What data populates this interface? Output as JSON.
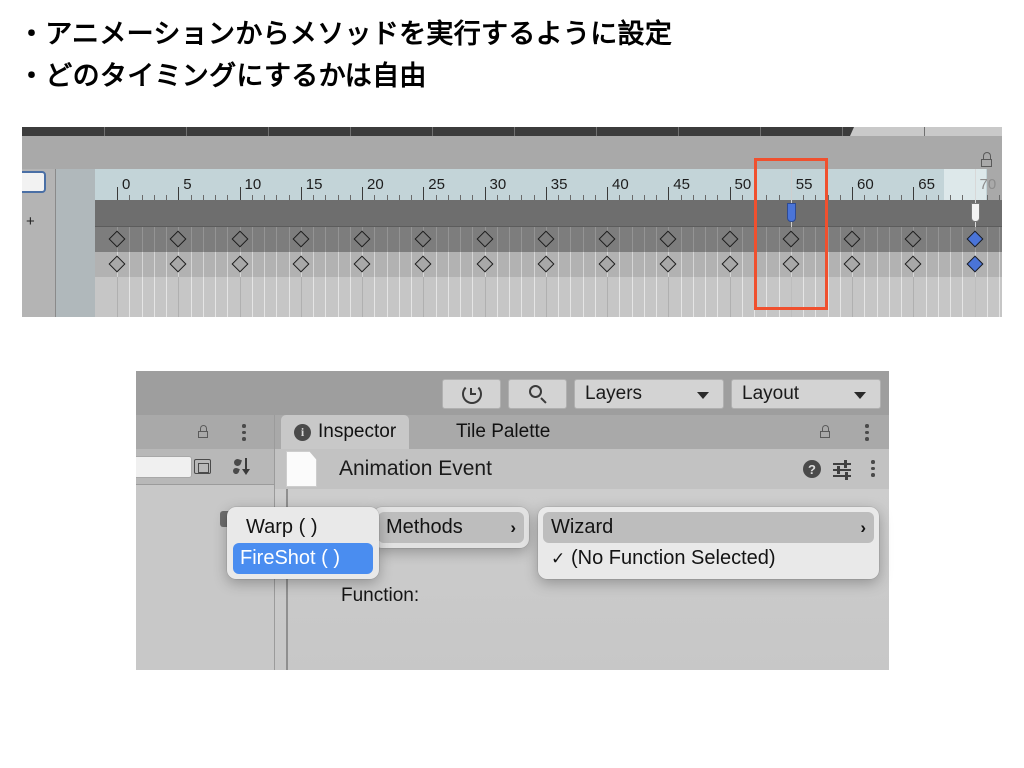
{
  "slide": {
    "bullets": [
      "・アニメーションからメソッドを実行するように設定",
      "・どのタイミングにするかは自由"
    ]
  },
  "timeline": {
    "ruler": {
      "labels": [
        "0",
        "5",
        "10",
        "15",
        "20",
        "25",
        "30",
        "35",
        "40",
        "45",
        "50",
        "55",
        "60",
        "65",
        "70"
      ],
      "frame_start": 0,
      "frame_end": 70,
      "tick_step": 5,
      "minor_per_major": 5
    },
    "playheads": [
      {
        "name": "current-frame-marker",
        "frame": 55,
        "color": "#4a74d8"
      },
      {
        "name": "end-frame-marker",
        "frame": 70,
        "color": "#f4f4f4"
      }
    ],
    "keyframe_rows": [
      {
        "name": "summary-row",
        "frames": [
          0,
          5,
          10,
          15,
          20,
          25,
          30,
          35,
          40,
          45,
          50,
          55,
          60,
          65,
          70
        ],
        "selected_frames": [
          70
        ]
      },
      {
        "name": "event-row",
        "frames": [
          0,
          5,
          10,
          15,
          20,
          25,
          30,
          35,
          40,
          45,
          50,
          55,
          60,
          65,
          70
        ],
        "selected_frames": [
          70
        ]
      }
    ],
    "highlight": {
      "name": "red-selection-box",
      "color": "#f0502e",
      "frame_from": 52,
      "frame_to": 58
    },
    "add_button_label": "+",
    "lock_icon": "lock-icon"
  },
  "unity": {
    "toolbar": {
      "history_icon": "history-icon",
      "search_icon": "search-icon",
      "layers_label": "Layers",
      "layout_label": "Layout",
      "dropdown_icon": "chevron-down-icon"
    },
    "left_panel": {
      "lock_icon": "lock-icon",
      "menu_icon": "kebab-menu-icon",
      "expand_icon": "expand-window-icon",
      "sort_icon": "sort-icon"
    },
    "tabs": [
      {
        "label": "Inspector",
        "icon": "info-icon",
        "active": true
      },
      {
        "label": "Tile Palette",
        "icon": "",
        "active": false
      }
    ],
    "tab_lock_icon": "lock-icon",
    "tab_menu_icon": "kebab-menu-icon",
    "component": {
      "icon": "script-asset-icon",
      "title": "Animation Event",
      "help_icon": "help-icon",
      "preset_icon": "preset-sliders-icon",
      "menu_icon": "kebab-menu-icon"
    },
    "body": {
      "function_label": "Function:",
      "script_icon": "script-icon"
    },
    "menus": {
      "methods_menu": {
        "items": [
          {
            "label": "Methods",
            "has_submenu": true,
            "state": "hover",
            "arrow": "›"
          }
        ]
      },
      "functions_menu": {
        "items": [
          {
            "label": "Warp ( )",
            "state": "normal",
            "checked": false
          },
          {
            "label": "FireShot ( )",
            "state": "selected",
            "checked": false
          }
        ]
      },
      "wizard_menu": {
        "items": [
          {
            "label": "Wizard",
            "has_submenu": true,
            "state": "hover",
            "arrow": "›",
            "checked": false
          },
          {
            "label": "(No Function Selected)",
            "state": "normal",
            "checked": true,
            "check_glyph": "✓"
          }
        ]
      }
    }
  }
}
